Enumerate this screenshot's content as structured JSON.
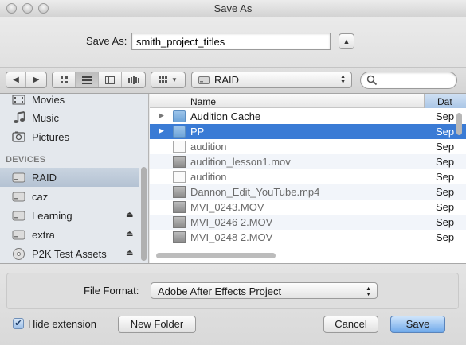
{
  "window": {
    "title": "Save As"
  },
  "saveas": {
    "label": "Save As:",
    "value": "smith_project_titles"
  },
  "toolbar": {
    "location": "RAID",
    "view_icons": [
      "icon-view",
      "list-view",
      "column-view",
      "coverflow-view"
    ],
    "active_view": "list-view"
  },
  "sidebar": {
    "items": [
      {
        "label": "Movies",
        "icon": "movies-icon"
      },
      {
        "label": "Music",
        "icon": "music-icon"
      },
      {
        "label": "Pictures",
        "icon": "pictures-icon"
      }
    ],
    "devices_header": "DEVICES",
    "devices": [
      {
        "label": "RAID",
        "icon": "disk-icon",
        "selected": true,
        "eject": false
      },
      {
        "label": "caz",
        "icon": "disk-icon",
        "selected": false,
        "eject": false
      },
      {
        "label": "Learning",
        "icon": "disk-icon",
        "selected": false,
        "eject": true
      },
      {
        "label": "extra",
        "icon": "disk-icon",
        "selected": false,
        "eject": true
      },
      {
        "label": "P2K Test Assets",
        "icon": "disc-icon",
        "selected": false,
        "eject": true
      }
    ]
  },
  "files": {
    "columns": {
      "name": "Name",
      "date": "Dat"
    },
    "rows": [
      {
        "name": "Audition Cache",
        "date": "Sep",
        "kind": "folder",
        "expandable": true,
        "selected": false,
        "dim": false
      },
      {
        "name": "PP",
        "date": "Sep",
        "kind": "folder",
        "expandable": true,
        "selected": true,
        "dim": false
      },
      {
        "name": " audition",
        "date": "Sep",
        "kind": "doc",
        "expandable": false,
        "selected": false,
        "dim": true
      },
      {
        "name": "audition_lesson1.mov",
        "date": "Sep",
        "kind": "mov",
        "expandable": false,
        "selected": false,
        "dim": true
      },
      {
        "name": "audition",
        "date": "Sep",
        "kind": "doc",
        "expandable": false,
        "selected": false,
        "dim": true
      },
      {
        "name": "Dannon_Edit_YouTube.mp4",
        "date": "Sep",
        "kind": "mov",
        "expandable": false,
        "selected": false,
        "dim": true
      },
      {
        "name": "MVI_0243.MOV",
        "date": "Sep",
        "kind": "mov",
        "expandable": false,
        "selected": false,
        "dim": true
      },
      {
        "name": "MVI_0246 2.MOV",
        "date": "Sep",
        "kind": "mov",
        "expandable": false,
        "selected": false,
        "dim": true
      },
      {
        "name": "MVI_0248 2.MOV",
        "date": "Sep",
        "kind": "mov",
        "expandable": false,
        "selected": false,
        "dim": true
      }
    ]
  },
  "format": {
    "label": "File Format:",
    "value": "Adobe After Effects Project"
  },
  "options": {
    "hide_extension_label": "Hide extension",
    "hide_extension_checked": true
  },
  "buttons": {
    "new_folder": "New Folder",
    "cancel": "Cancel",
    "save": "Save"
  }
}
